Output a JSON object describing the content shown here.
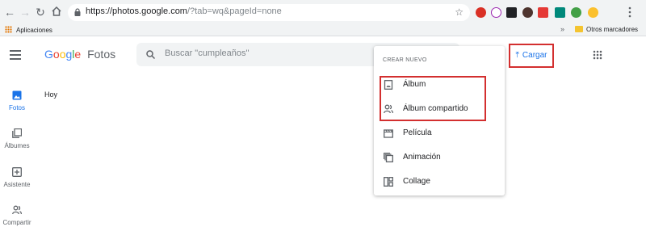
{
  "browser": {
    "url_main": "https://photos.google.com",
    "url_rest": "/?tab=wq&pageId=none",
    "bookmarks": {
      "apps_label": "Aplicaciones",
      "more": "»",
      "other_label": "Otros marcadores"
    }
  },
  "header": {
    "logo_google": "Google",
    "logo_product": "Fotos",
    "search_placeholder": "Buscar \"cumpleaños\"",
    "upload_label": "Cargar"
  },
  "rail": {
    "items": [
      {
        "label": "Fotos",
        "icon": "photo-icon",
        "active": true
      },
      {
        "label": "Álbumes",
        "icon": "albums-icon",
        "active": false
      },
      {
        "label": "Asistente",
        "icon": "assistant-icon",
        "active": false
      },
      {
        "label": "Compartir",
        "icon": "sharing-icon",
        "active": false
      }
    ]
  },
  "main": {
    "section_label": "Hoy"
  },
  "menu": {
    "title": "CREAR NUEVO",
    "items": [
      {
        "label": "Álbum",
        "icon": "album-icon"
      },
      {
        "label": "Álbum compartido",
        "icon": "shared-album-icon"
      },
      {
        "label": "Película",
        "icon": "movie-icon"
      },
      {
        "label": "Animación",
        "icon": "animation-icon"
      },
      {
        "label": "Collage",
        "icon": "collage-icon"
      }
    ]
  },
  "colors": {
    "accent": "#1a73e8",
    "highlight": "#d32f2f",
    "icon_grey": "#5f6368"
  }
}
